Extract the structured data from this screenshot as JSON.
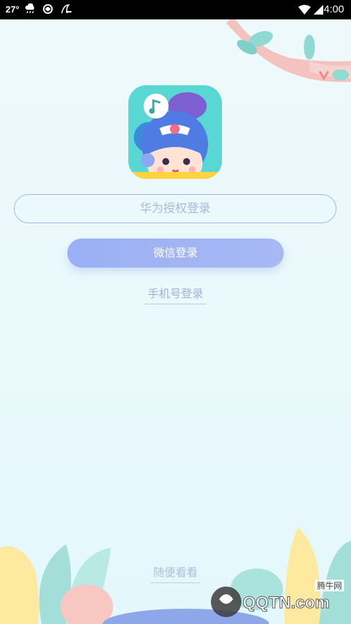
{
  "status_bar": {
    "temperature": "27°",
    "time": "4:00"
  },
  "login": {
    "huawei_label": "华为授权登录",
    "wechat_label": "微信登录",
    "phone_label": "手机号登录",
    "browse_label": "随便看看"
  },
  "watermark": {
    "brand": "QQTN.com",
    "site_name": "腾牛网"
  },
  "colors": {
    "background": "#eef9fb",
    "wechat_button": "#9ab0f4",
    "outline": "#9fb9e6",
    "link_text": "#9cb3de"
  }
}
